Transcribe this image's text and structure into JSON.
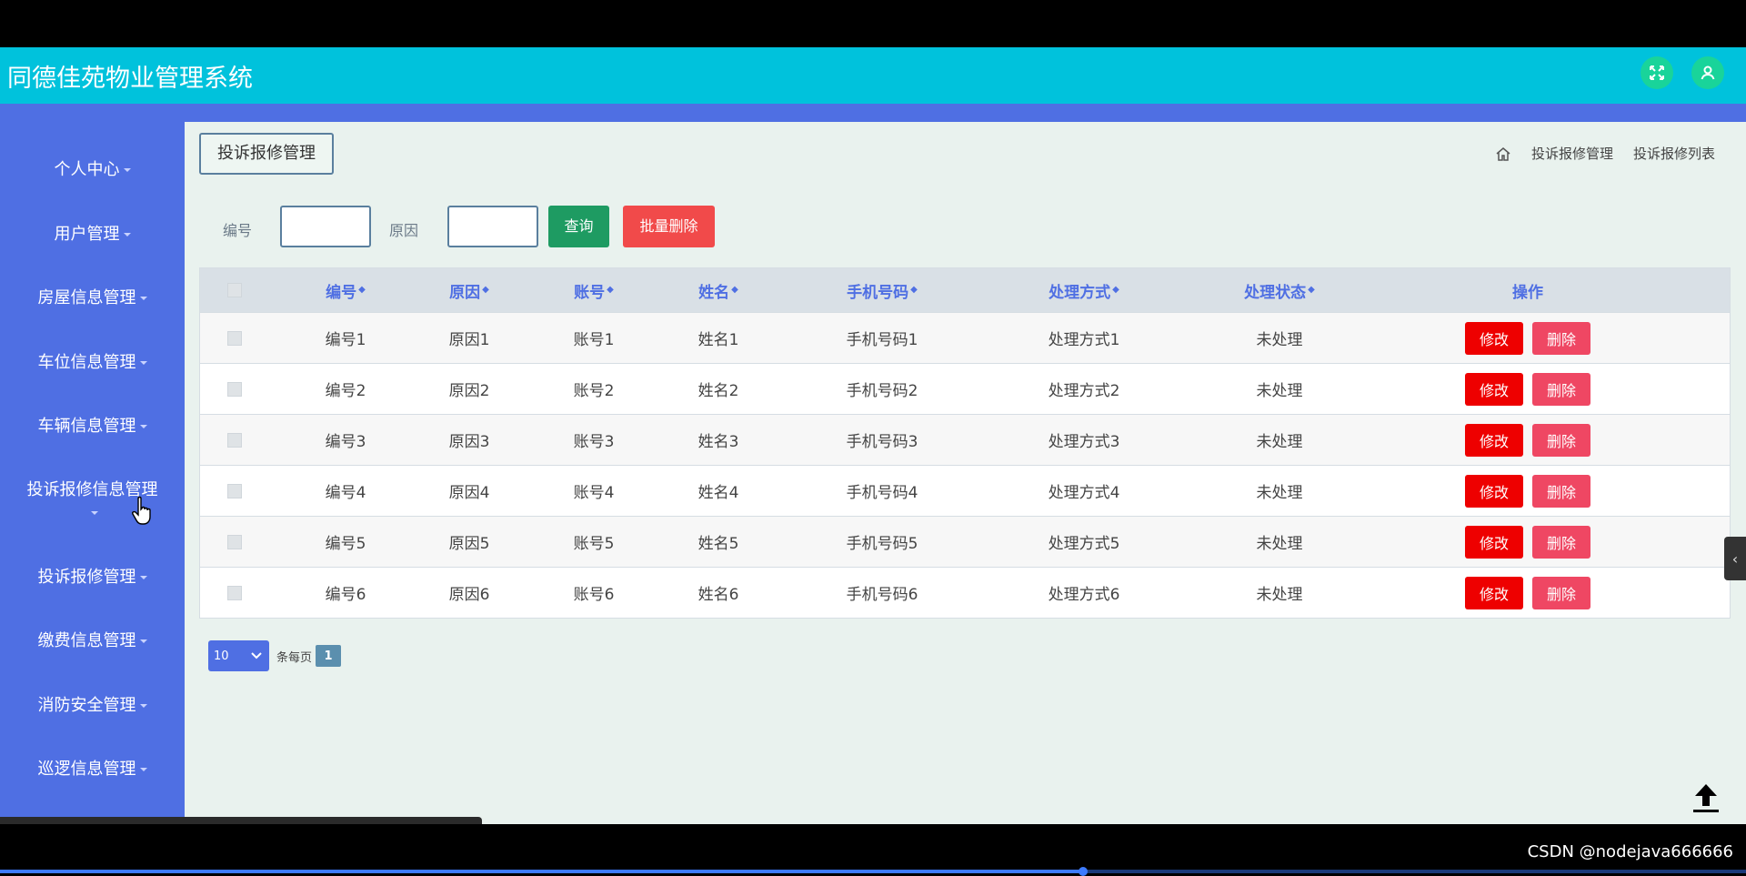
{
  "app": {
    "title": "同德佳苑物业管理系统"
  },
  "header_icons": {
    "fullscreen": "fullscreen-icon",
    "user": "user-icon"
  },
  "sidebar": {
    "items": [
      {
        "label": "个人中心"
      },
      {
        "label": "用户管理"
      },
      {
        "label": "房屋信息管理"
      },
      {
        "label": "车位信息管理"
      },
      {
        "label": "车辆信息管理"
      },
      {
        "label": "投诉报修信息管理"
      },
      {
        "label": "投诉报修管理"
      },
      {
        "label": "缴费信息管理"
      },
      {
        "label": "消防安全管理"
      },
      {
        "label": "巡逻信息管理"
      }
    ]
  },
  "page": {
    "tag": "投诉报修管理",
    "breadcrumb": [
      "投诉报修管理",
      "投诉报修列表"
    ]
  },
  "search": {
    "field1_label": "编号",
    "field2_label": "原因",
    "query_label": "查询",
    "batch_delete_label": "批量删除"
  },
  "table": {
    "columns": [
      "编号",
      "原因",
      "账号",
      "姓名",
      "手机号码",
      "处理方式",
      "处理状态",
      "操作"
    ],
    "rows": [
      {
        "id": "编号1",
        "reason": "原因1",
        "account": "账号1",
        "name": "姓名1",
        "phone": "手机号码1",
        "method": "处理方式1",
        "status": "未处理"
      },
      {
        "id": "编号2",
        "reason": "原因2",
        "account": "账号2",
        "name": "姓名2",
        "phone": "手机号码2",
        "method": "处理方式2",
        "status": "未处理"
      },
      {
        "id": "编号3",
        "reason": "原因3",
        "account": "账号3",
        "name": "姓名3",
        "phone": "手机号码3",
        "method": "处理方式3",
        "status": "未处理"
      },
      {
        "id": "编号4",
        "reason": "原因4",
        "account": "账号4",
        "name": "姓名4",
        "phone": "手机号码4",
        "method": "处理方式4",
        "status": "未处理"
      },
      {
        "id": "编号5",
        "reason": "原因5",
        "account": "账号5",
        "name": "姓名5",
        "phone": "手机号码5",
        "method": "处理方式5",
        "status": "未处理"
      },
      {
        "id": "编号6",
        "reason": "原因6",
        "account": "账号6",
        "name": "姓名6",
        "phone": "手机号码6",
        "method": "处理方式6",
        "status": "未处理"
      }
    ],
    "edit_label": "修改",
    "delete_label": "删除"
  },
  "pager": {
    "page_size": "10",
    "per_page_text": "条每页",
    "current_page": "1"
  },
  "watermark": "CSDN @nodejava666666",
  "colors": {
    "header": "#00c2dc",
    "sidebar": "#4f6fe3",
    "query_button": "#1e9b62",
    "batch_delete_button": "#f14a4a",
    "edit_button": "#ee0000",
    "delete_button": "#ef4763"
  }
}
